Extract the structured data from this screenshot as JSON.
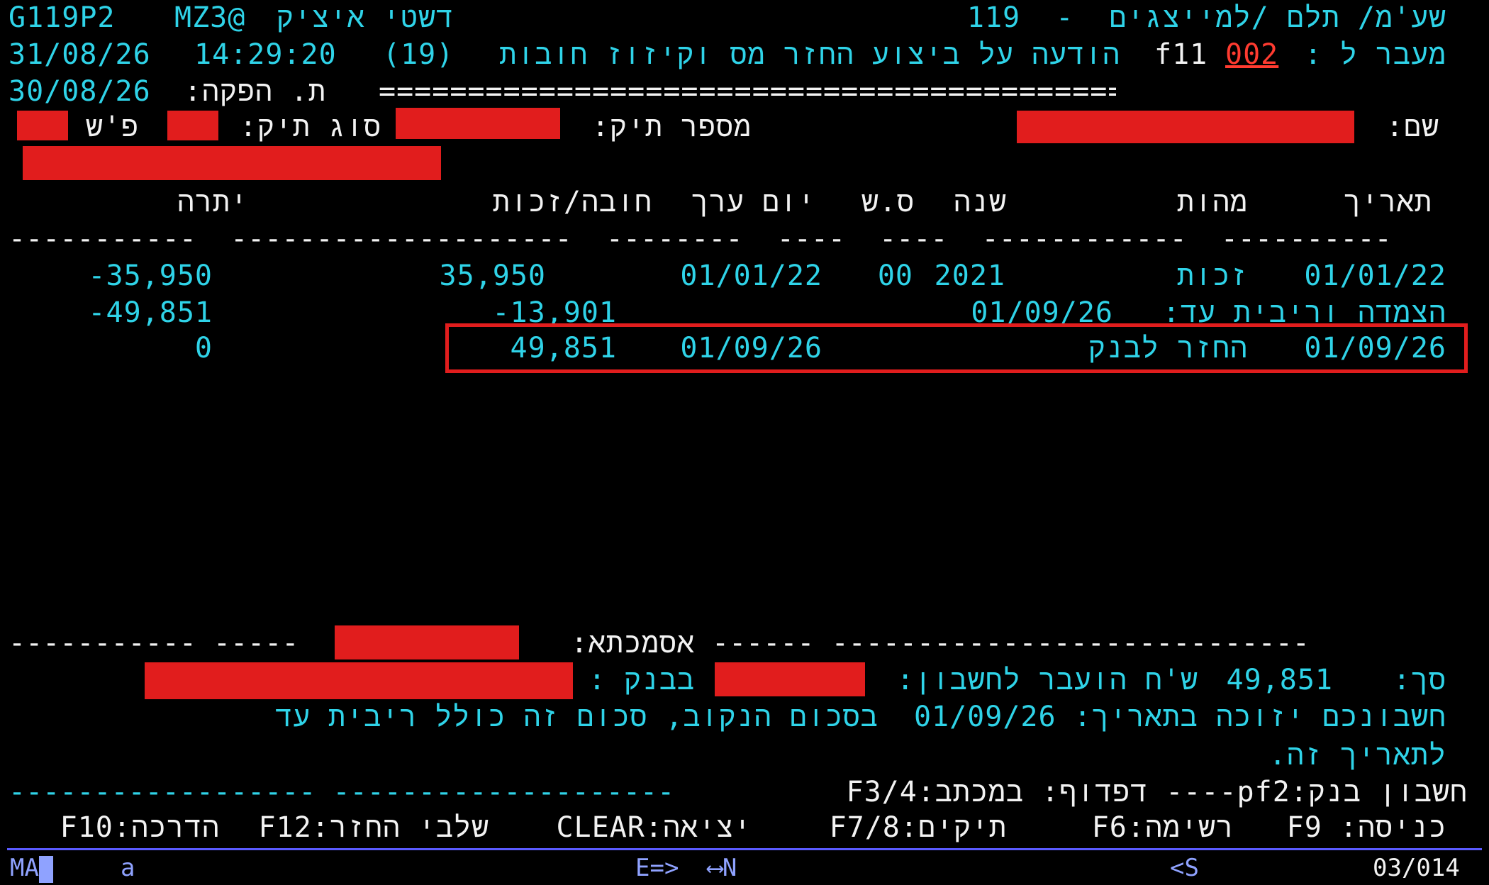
{
  "header": {
    "program_id": "G119P2",
    "user_id": "MZ3@",
    "user_name": "דשטי איציק",
    "app_title": "שע'מ/ תלם /למייצגים  -  119",
    "date": "31/08/26",
    "time": "14:29:20",
    "screen_code": "(19)",
    "screen_title": "הודעה על ביצוע החזר מס וקיזוז חובות",
    "fkey": "f11",
    "goto_value": "002",
    "goto_label": "מעבר ל :",
    "issue_date": "30/08/26",
    "issue_date_label": "ת. הפקה:",
    "separator": "=========================================="
  },
  "file_info": {
    "name_label": "שם:",
    "file_number_label": "מספר תיק:",
    "file_type_label": "סוג תיק:",
    "ps_label": "פ'ש"
  },
  "table": {
    "columns": [
      "תאריך",
      "מהות",
      "שנה",
      "ס.ש",
      "יום ערך",
      "חובה/זכות",
      "יתרה"
    ],
    "rows": [
      {
        "date": "01/01/22",
        "nature": "זכות",
        "year": "2021",
        "ss": "00",
        "value_date": "01/01/22",
        "debit_credit": "35,950",
        "balance": "-35,950"
      },
      {
        "label": "הצמדה וריבית עד:",
        "until": "01/09/26",
        "debit_credit": "-13,901",
        "balance": "-49,851"
      },
      {
        "date": "01/09/26",
        "nature": "החזר לבנק",
        "value_date": "01/09/26",
        "debit_credit": "49,851",
        "balance": "0"
      }
    ]
  },
  "summary": {
    "reference_label": "אסמכתא:",
    "total_label": "סך:",
    "total_value": "49,851",
    "transfer_text": "ש'ח הועבר לחשבון:",
    "bank_label": "בבנק :",
    "message_line1": "חשבונכם יזוכה בתאריך: 01/09/26  בסכום הנקוב, סכום זה כולל ריבית עד",
    "message_line2": "לתאריך זה."
  },
  "fkeys": {
    "row1_right": "חשבון בנק:pf2---- דפדוף: במכתב:F3/4",
    "row2": [
      "כניסה: F9",
      "רשימה:F6",
      "תיקים:F7/8",
      "יציאה:CLEAR",
      "שלבי החזר:F12",
      "הדרכה:F10"
    ]
  },
  "status_bar": {
    "mode": "MA",
    "indicator": "a",
    "arrows": "E=>  ⟷N",
    "s_indicator": "<S",
    "position": "03/014"
  },
  "colors": {
    "text": "#2fd3e8",
    "highlight": "#e11d1d",
    "background": "#000000"
  }
}
